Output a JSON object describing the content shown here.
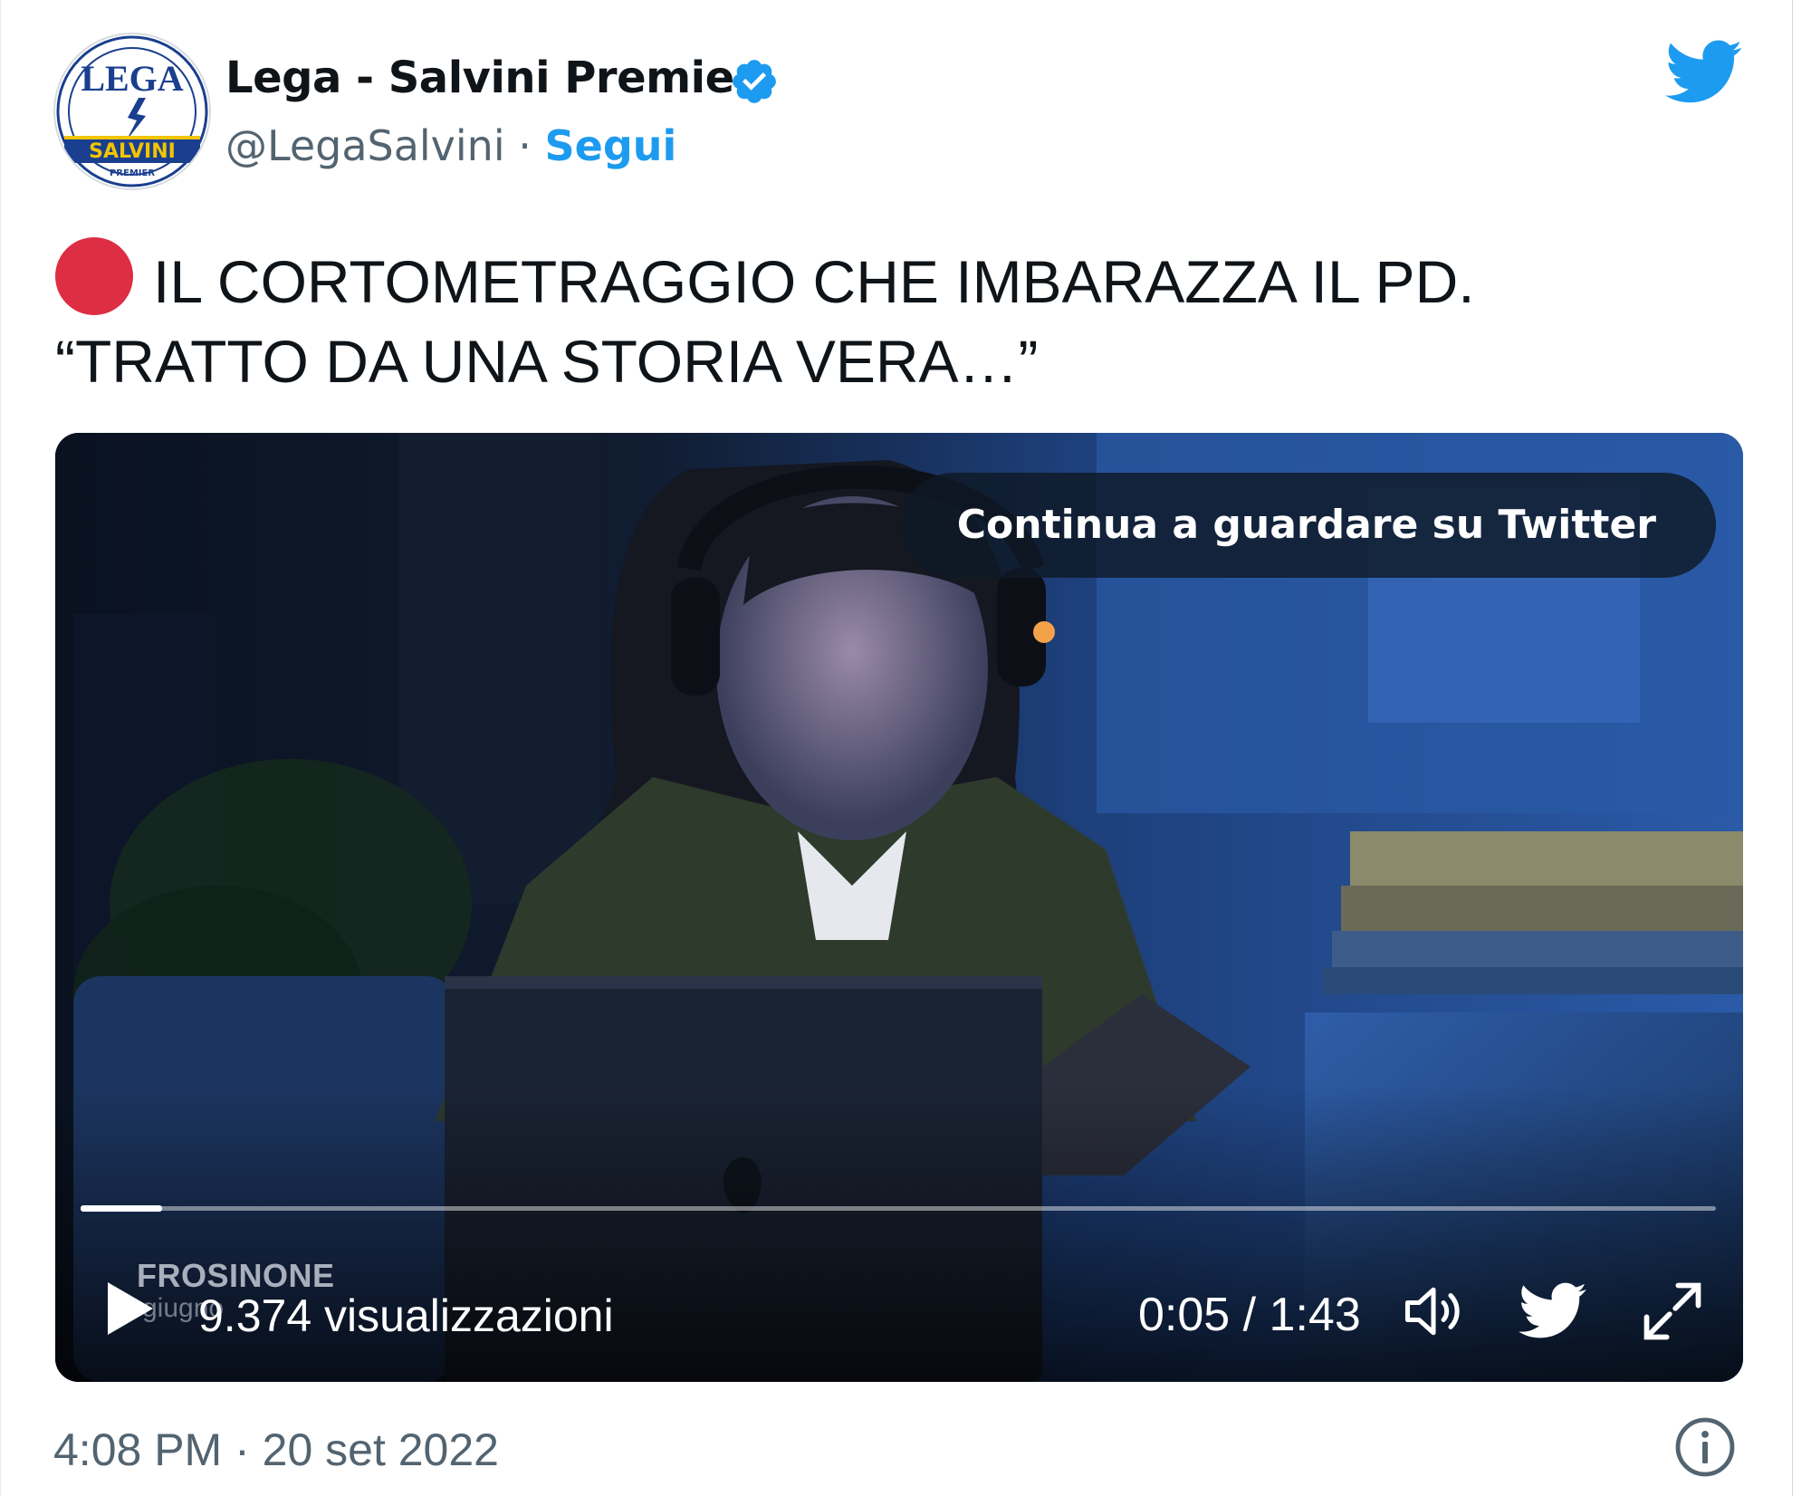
{
  "author": {
    "name": "Lega - Salvini Premier",
    "handle": "@LegaSalvini",
    "separator": "·",
    "follow_label": "Segui",
    "avatar": {
      "top_text": "LEGA",
      "banner_text": "SALVINI",
      "bottom_text": "PREMIER"
    },
    "verified": true
  },
  "tweet": {
    "text_line1": "IL CORTOMETRAGGIO CHE IMBARAZZA IL PD.",
    "text_line2": "“TRATTO DA UNA STORIA VERA…”"
  },
  "video": {
    "continue_label": "Continua a guardare su Twitter",
    "overlay_location": "FROSINONE",
    "overlay_date": "giugno",
    "views": "9.374 visualizzazioni",
    "time_display": "0:05 / 1:43",
    "progress_fraction": 0.05
  },
  "footer": {
    "timestamp": "4:08 PM · 20 set 2022"
  },
  "icons": {
    "twitter_bird": "twitter-bird-icon",
    "verified": "verified-badge-icon",
    "play": "play-icon",
    "volume": "volume-icon",
    "fullscreen": "fullscreen-icon",
    "info": "info-icon"
  },
  "colors": {
    "twitter_blue": "#1d9bf0",
    "text_primary": "#0f1419",
    "text_secondary": "#536471",
    "red_circle": "#dd2e44"
  }
}
